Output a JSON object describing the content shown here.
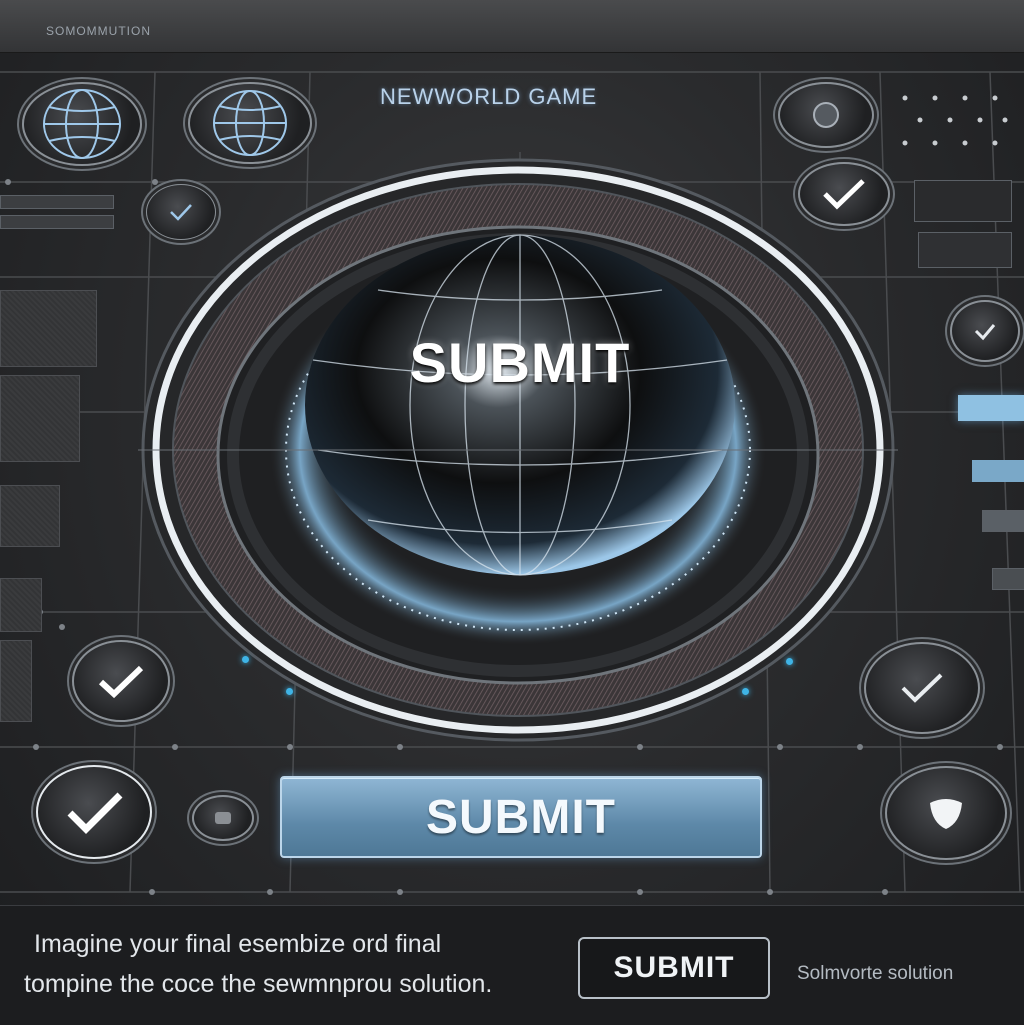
{
  "header": {
    "top_label": "SOMOMMUTION",
    "title": "NEWWORLD GAME"
  },
  "hub": {
    "center_label": "SUBMIT"
  },
  "main_button": {
    "label": "SUBMIT"
  },
  "footer": {
    "caption_line1": "Imagine your final esembize ord final",
    "caption_line2": "tompine the coce the sewmnprou solution.",
    "submit_label": "SUBMIT",
    "side_label": "Solmvorte solution"
  },
  "icons": {
    "globe": "globe-icon",
    "check": "check-icon",
    "shield": "shield-icon",
    "toggle": "toggle-icon"
  },
  "colors": {
    "accent": "#8fb6d4",
    "glow": "#3fb4e6",
    "background": "#2a2b2d"
  }
}
